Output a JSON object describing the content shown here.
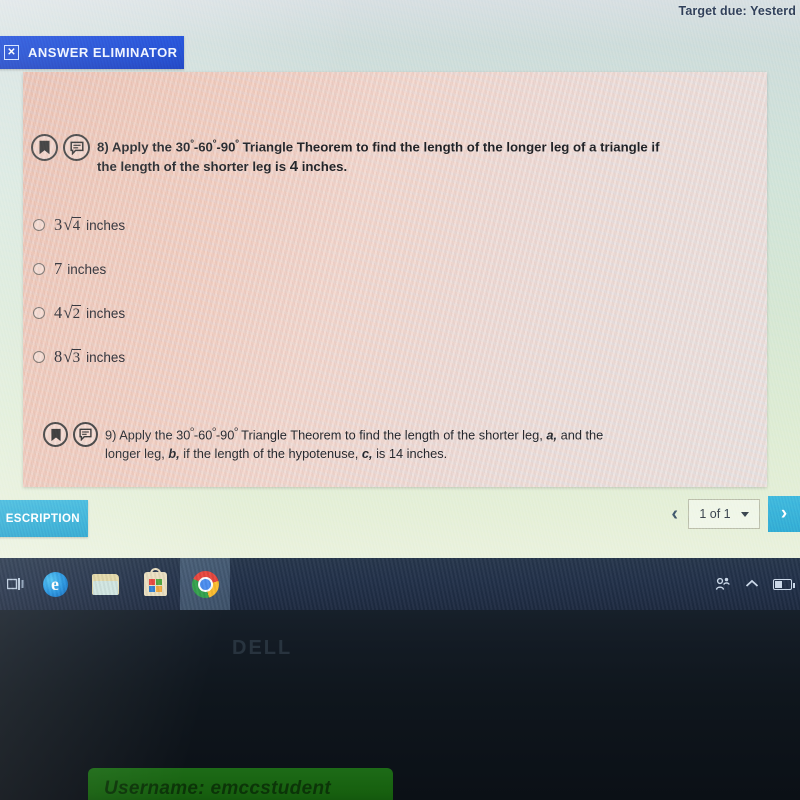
{
  "header": {
    "target_due": "Target due: Yesterd",
    "answer_eliminator": {
      "icon": "x-box-icon",
      "label": "ANSWER ELIMINATOR"
    }
  },
  "question_1": {
    "bookmark_icon": "bookmark-icon",
    "comment_icon": "comment-icon",
    "number": "8)",
    "line1_a": " Apply the 30",
    "deg": "º",
    "line1_b": "-60",
    "line1_c": "-90",
    "line1_d": " Triangle Theorem to find the length of the longer leg of a triangle if",
    "line2_a": "the length of the shorter leg is ",
    "line2_value": "4",
    "line2_b": " inches.",
    "options": [
      {
        "coefficient": "3",
        "radical": "4",
        "units": "inches",
        "selected": false
      },
      {
        "coefficient": "7",
        "radical": "",
        "units": "inches",
        "selected": false
      },
      {
        "coefficient": "4",
        "radical": "2",
        "units": "inches",
        "selected": false
      },
      {
        "coefficient": "8",
        "radical": "3",
        "units": "inches",
        "selected": false
      }
    ]
  },
  "question_2": {
    "bookmark_icon": "bookmark-icon",
    "comment_icon": "comment-icon",
    "number": "9)",
    "line1_a": " Apply the 30",
    "line1_b": "-60",
    "line1_c": "-90",
    "line1_d": " Triangle Theorem to find the length of the shorter leg, ",
    "var_a": "a,",
    "line1_e": " and the",
    "line2_a": "longer leg, ",
    "var_b": "b,",
    "line2_b": " if the length of the hypotenuse, ",
    "var_c": "c,",
    "line2_c": " is 14 inches."
  },
  "bottom_toolbar": {
    "description_label": "ESCRIPTION",
    "prev_icon": "chevron-left-icon",
    "page_indicator": "1 of 1",
    "dropdown_icon": "caret-down-icon",
    "next_icon": "chevron-right-icon"
  },
  "taskbar": {
    "start_icon": "task-view-icon",
    "items": [
      {
        "icon": "edge-icon",
        "label": "Microsoft Edge",
        "glyph": "e",
        "active": false
      },
      {
        "icon": "file-explorer-icon",
        "label": "File Explorer",
        "active": false
      },
      {
        "icon": "microsoft-store-icon",
        "label": "Microsoft Store",
        "active": false
      },
      {
        "icon": "chrome-icon",
        "label": "Google Chrome",
        "active": true
      }
    ],
    "tray": [
      {
        "icon": "people-icon",
        "glyph": "ʘ"
      },
      {
        "icon": "show-hidden-icons-icon",
        "glyph": "˄"
      },
      {
        "icon": "battery-icon"
      }
    ]
  },
  "monitor": {
    "brand_logo": "DELL"
  },
  "overlay_note": {
    "text": "Username: emccstudent"
  },
  "colors": {
    "answer_eliminator_blue": "#1746d8",
    "description_teal": "#33abd4",
    "next_button_teal": "#31a9d2",
    "panel_peach": "#eec2b2",
    "taskbar_navy": "#22314a",
    "note_green": "#17600f"
  }
}
